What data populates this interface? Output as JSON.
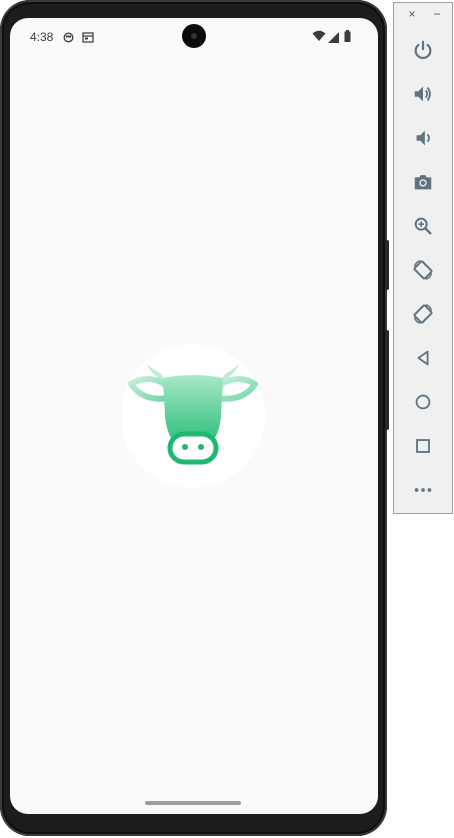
{
  "status_bar": {
    "time": "4:38",
    "icons": [
      "notification-icon",
      "calendar-icon",
      "wifi-icon",
      "signal-icon",
      "battery-icon"
    ]
  },
  "app": {
    "logo": "cow-head-icon",
    "accent_color": "#2ec27e",
    "accent_light": "#9ee6c2"
  },
  "emulator_toolbar": {
    "close_label": "×",
    "minimize_label": "−",
    "buttons": [
      "power",
      "volume-up",
      "volume-down",
      "screenshot",
      "zoom",
      "rotate-left",
      "rotate-right",
      "back",
      "home",
      "overview",
      "more"
    ]
  }
}
